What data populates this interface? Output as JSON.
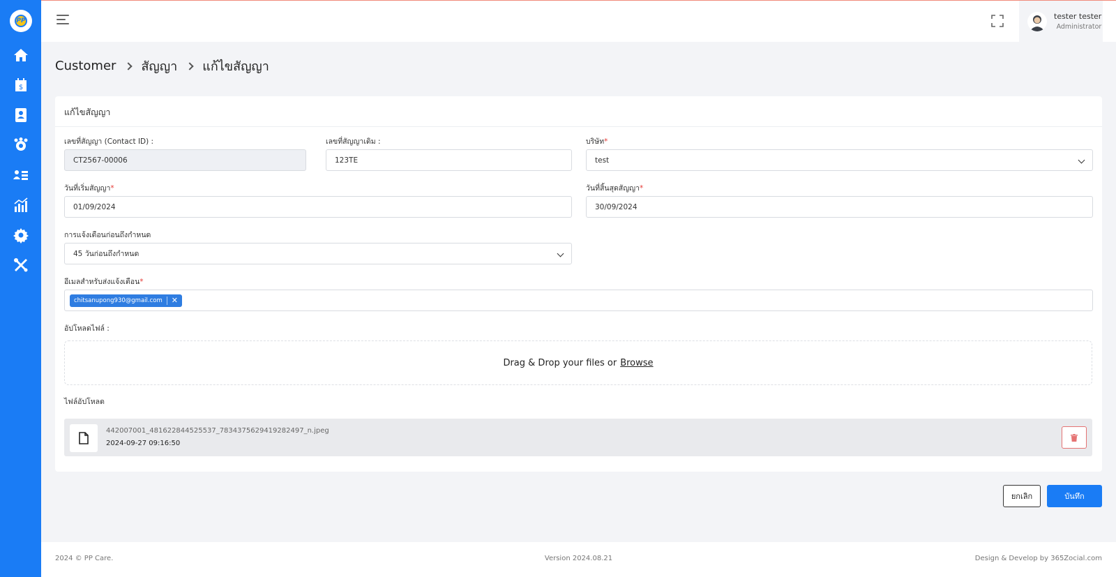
{
  "sidebar": {
    "logo_text": "PP",
    "items": [
      {
        "icon": "home-icon"
      },
      {
        "icon": "calendar-billing-icon"
      },
      {
        "icon": "contact-book-icon"
      },
      {
        "icon": "team-gear-icon"
      },
      {
        "icon": "user-list-icon"
      },
      {
        "icon": "chart-icon"
      },
      {
        "icon": "settings-icon"
      },
      {
        "icon": "tools-icon"
      }
    ],
    "active_index": 2
  },
  "topbar": {
    "user_name": "tester tester",
    "user_role": "Administrator"
  },
  "breadcrumb": [
    "Customer",
    "สัญญา",
    "แก้ไขสัญญา"
  ],
  "card": {
    "title": "แก้ไขสัญญา",
    "contract_id": {
      "label": "เลขที่สัญญา (Contact ID) :",
      "value": "CT2567-00006"
    },
    "old_contract": {
      "label": "เลขที่สัญญาเดิม :",
      "value": "123TE"
    },
    "company": {
      "label": "บริษัท",
      "value": "test"
    },
    "start_date": {
      "label": "วันที่เริ่มสัญญา",
      "value": "01/09/2024"
    },
    "end_date": {
      "label": "วันที่สิ้นสุดสัญญา",
      "value": "30/09/2024"
    },
    "reminder": {
      "label": "การแจ้งเตือนก่อนถึงกำหนด",
      "value": "45 วันก่อนถึงกำหนด"
    },
    "email": {
      "label": "อีเมลสำหรับส่งแจ้งเตือน",
      "tags": [
        "chitsanupong930@gmail.com"
      ]
    },
    "upload": {
      "label": "อัปโหลดไฟล์ :",
      "text": "Drag & Drop your files or",
      "browse": "Browse"
    },
    "uploaded": {
      "label": "ไฟล์อัปโหลด",
      "files": [
        {
          "name": "442007001_481622844525537_7834375629419282497_n.jpeg",
          "date": "2024-09-27 09:16:50"
        }
      ]
    },
    "required_mark": "*"
  },
  "actions": {
    "cancel": "ยกเลิก",
    "save": "บันทึก"
  },
  "footer": {
    "copyright": "2024 © PP Care.",
    "version": "Version 2024.08.21",
    "credit": "Design & Develop by 365Zocial.com"
  },
  "colors": {
    "primary": "#1a7cf5",
    "danger": "#e53935"
  }
}
